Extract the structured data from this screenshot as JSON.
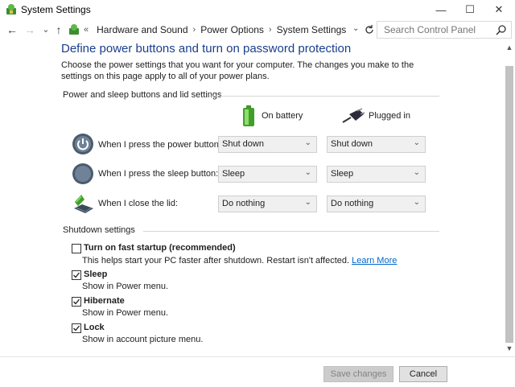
{
  "window": {
    "title": "System Settings",
    "minimize": "—",
    "maximize": "☐",
    "close": "✕"
  },
  "nav": {
    "back": "←",
    "forward": "→",
    "recent": "⌄",
    "up": "↑",
    "overflow": "«",
    "breadcrumbs": [
      "Hardware and Sound",
      "Power Options",
      "System Settings"
    ],
    "breadcrumb_sep": "›",
    "dropdown": "⌄"
  },
  "search": {
    "placeholder": "Search Control Panel"
  },
  "page": {
    "heading": "Define power buttons and turn on password protection",
    "description": "Choose the power settings that you want for your computer. The changes you make to the settings on this page apply to all of your power plans."
  },
  "power_group": {
    "label": "Power and sleep buttons and lid settings",
    "col_battery": "On battery",
    "col_plugged": "Plugged in",
    "rows": [
      {
        "label": "When I press the power button:",
        "battery": "Shut down",
        "plugged": "Shut down"
      },
      {
        "label": "When I press the sleep button:",
        "battery": "Sleep",
        "plugged": "Sleep"
      },
      {
        "label": "When I close the lid:",
        "battery": "Do nothing",
        "plugged": "Do nothing"
      }
    ]
  },
  "shutdown_group": {
    "label": "Shutdown settings",
    "items": [
      {
        "label": "Turn on fast startup (recommended)",
        "desc": "This helps start your PC faster after shutdown. Restart isn't affected.",
        "link": "Learn More",
        "checked": false
      },
      {
        "label": "Sleep",
        "desc": "Show in Power menu.",
        "checked": true
      },
      {
        "label": "Hibernate",
        "desc": "Show in Power menu.",
        "checked": true
      },
      {
        "label": "Lock",
        "desc": "Show in account picture menu.",
        "checked": true
      }
    ]
  },
  "footer": {
    "save_label": "Save changes",
    "cancel_label": "Cancel"
  },
  "scroll": {
    "up": "▲",
    "down": "▼"
  },
  "combo_chevron": "⌄"
}
